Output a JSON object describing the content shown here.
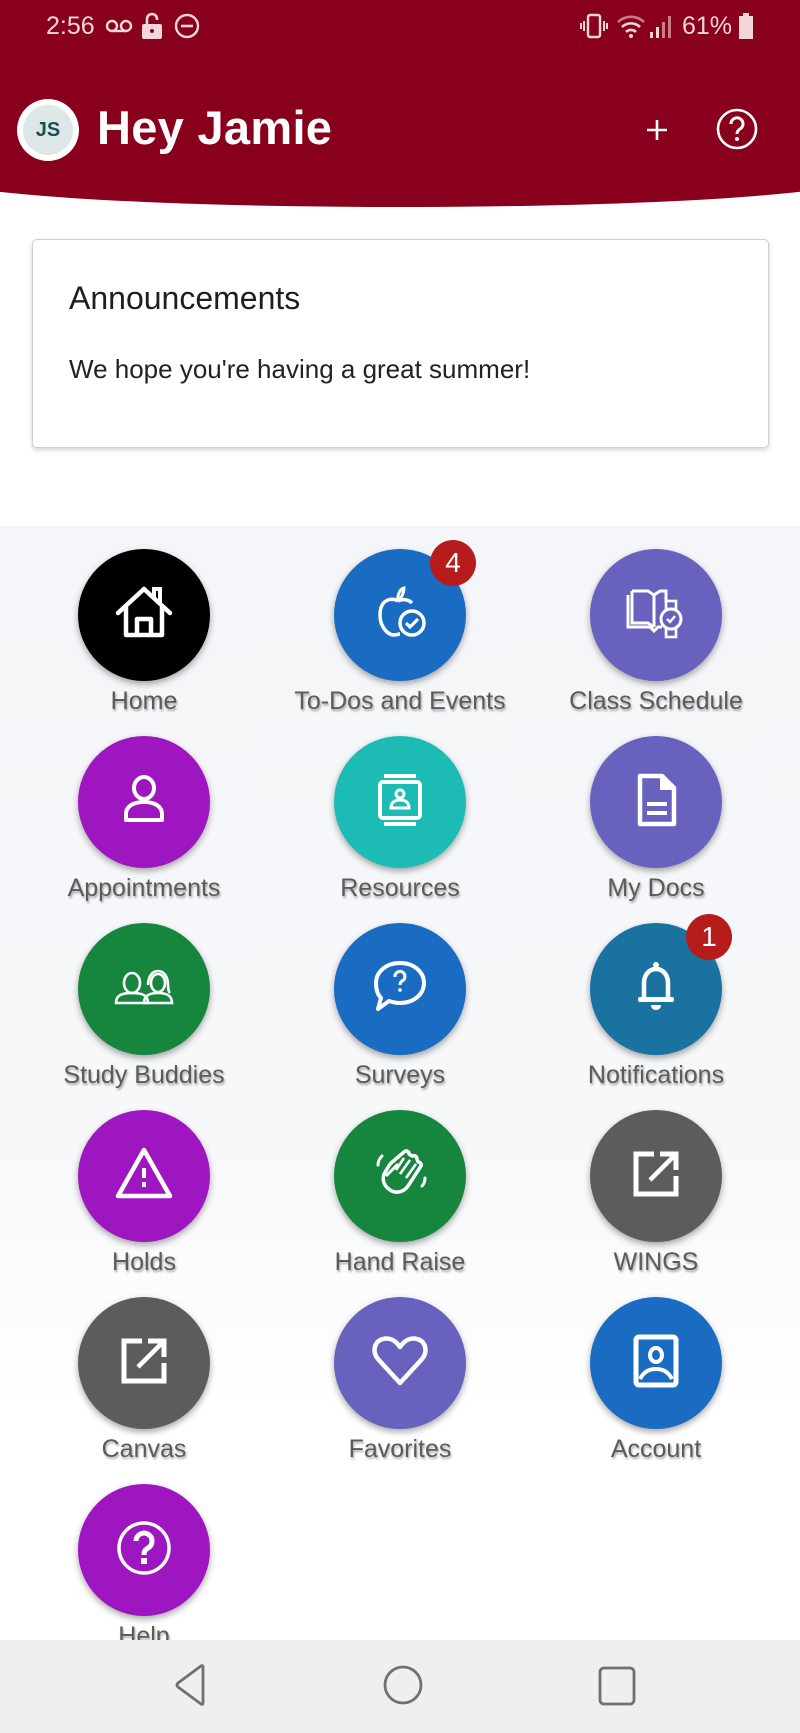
{
  "status_bar": {
    "time": "2:56",
    "left_icons": [
      "voicemail-icon",
      "lock-icon",
      "do-not-disturb-icon"
    ],
    "right_icons": [
      "vibrate-icon",
      "wifi-icon",
      "signal-icon",
      "battery-icon"
    ],
    "battery": "61%"
  },
  "header": {
    "avatar_initials": "JS",
    "greeting": "Hey Jamie",
    "add_label": "+",
    "help_label": "?",
    "color": "#88001b"
  },
  "announcements": {
    "title": "Announcements",
    "body": "We hope you're having a great summer!"
  },
  "tiles": [
    {
      "label": "Home",
      "icon": "home-icon",
      "color": "#000000"
    },
    {
      "label": "To-Dos and Events",
      "icon": "apple-check-icon",
      "color": "#1a6cc2",
      "badge": "4"
    },
    {
      "label": "Class Schedule",
      "icon": "book-watch-icon",
      "color": "#6861bd"
    },
    {
      "label": "Appointments",
      "icon": "person-icon",
      "color": "#9d16c0"
    },
    {
      "label": "Resources",
      "icon": "contact-book-icon",
      "color": "#1cbcb5"
    },
    {
      "label": "My Docs",
      "icon": "document-icon",
      "color": "#6861bd"
    },
    {
      "label": "Study Buddies",
      "icon": "two-people-icon",
      "color": "#16863f"
    },
    {
      "label": "Surveys",
      "icon": "question-bubble-icon",
      "color": "#1a6cc2"
    },
    {
      "label": "Notifications",
      "icon": "bell-icon",
      "color": "#1a72a0",
      "badge": "1"
    },
    {
      "label": "Holds",
      "icon": "warning-icon",
      "color": "#9d16c0"
    },
    {
      "label": "Hand Raise",
      "icon": "waving-hand-icon",
      "color": "#16863f"
    },
    {
      "label": "WINGS",
      "icon": "external-link-icon",
      "color": "#5c5c5c"
    },
    {
      "label": "Canvas",
      "icon": "external-link-icon",
      "color": "#5c5c5c"
    },
    {
      "label": "Favorites",
      "icon": "heart-icon",
      "color": "#6861bd"
    },
    {
      "label": "Account",
      "icon": "account-portrait-icon",
      "color": "#1a6cc2"
    },
    {
      "label": "Help",
      "icon": "help-circle-icon",
      "color": "#9d16c0"
    }
  ],
  "nav_bar": {
    "buttons": [
      "back-icon",
      "home-circle-icon",
      "recents-icon"
    ]
  }
}
